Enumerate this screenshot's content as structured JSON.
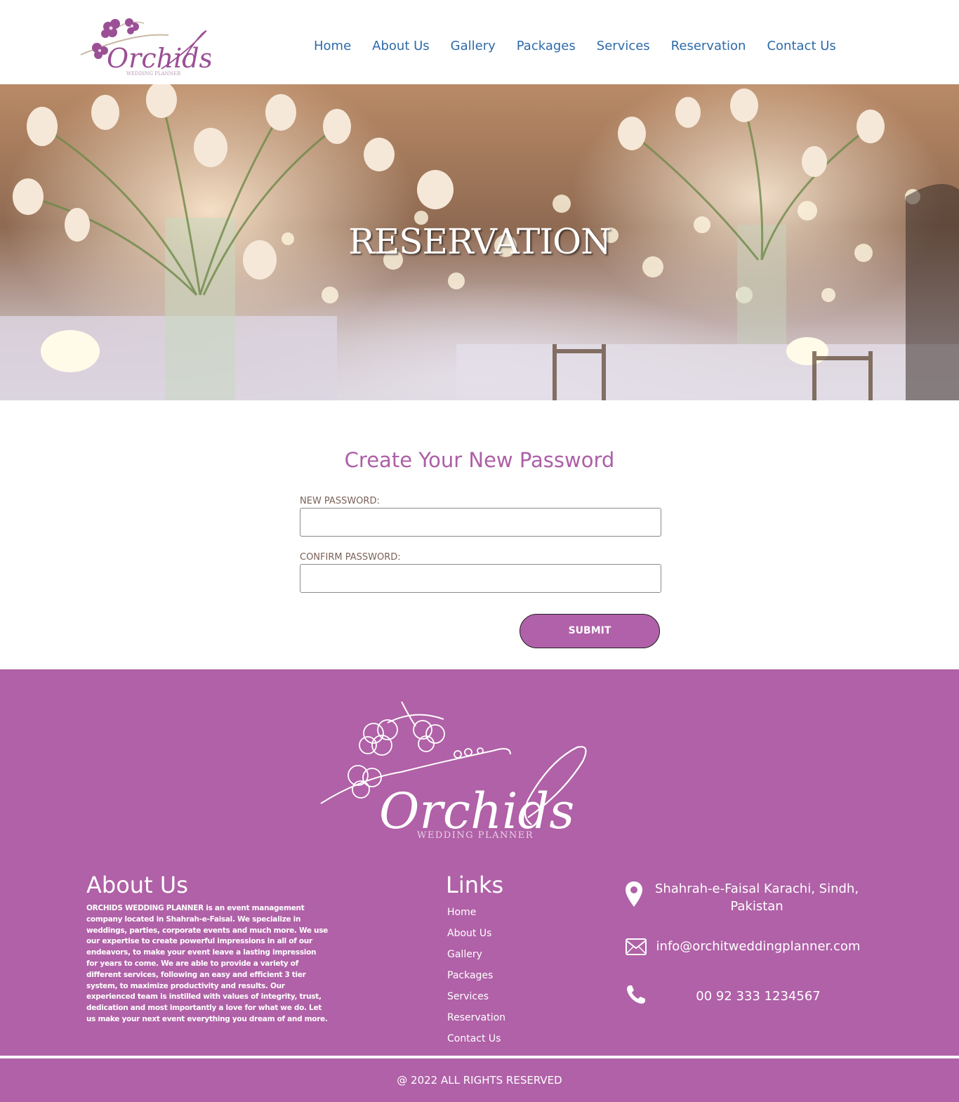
{
  "header": {
    "logo_text": "Orchids",
    "logo_subtext": "WEDDING PLANNER",
    "nav": [
      "Home",
      "About Us",
      "Gallery",
      "Packages",
      "Services",
      "Reservation",
      "Contact Us"
    ]
  },
  "hero": {
    "title": "RESERVATION"
  },
  "form": {
    "title": "Create Your New Password",
    "new_password_label": "NEW PASSWORD:",
    "new_password_value": "",
    "confirm_password_label": "CONFIRM PASSWORD:",
    "confirm_password_value": "",
    "submit_label": "SUBMIT"
  },
  "footer": {
    "logo_text": "Orchids",
    "logo_subtext": "WEDDING PLANNER",
    "about_heading": "About Us",
    "about_text": "ORCHIDS WEDDING PLANNER is an event management company located in Shahrah-e-Faisal. We specialize in weddings, parties, corporate events and much more. We use our expertise to create powerful impressions in all of our endeavors, to make your event leave a lasting impression for years to come. We are able to provide a variety of different services, following an easy and efficient 3 tier system, to maximize productivity and results. Our experienced team is instilled with values of integrity, trust, dedication and most importantly a love for what we do. Let us make your next event everything you dream of and more.",
    "links_heading": "Links",
    "links": [
      "Home",
      "About Us",
      "Gallery",
      "Packages",
      "Services",
      "Reservation",
      "Contact Us"
    ],
    "address_line1": "Shahrah-e-Faisal Karachi, Sindh,",
    "address_line2": "Pakistan",
    "email": "info@orchitweddingplanner.com",
    "phone": "00 92 333 1234567",
    "copyright": "@ 2022 ALL RIGHTS RESERVED"
  },
  "colors": {
    "brand_purple": "#b061a7",
    "heading_purple": "#ad5fa6",
    "nav_blue": "#2e6aa8"
  }
}
